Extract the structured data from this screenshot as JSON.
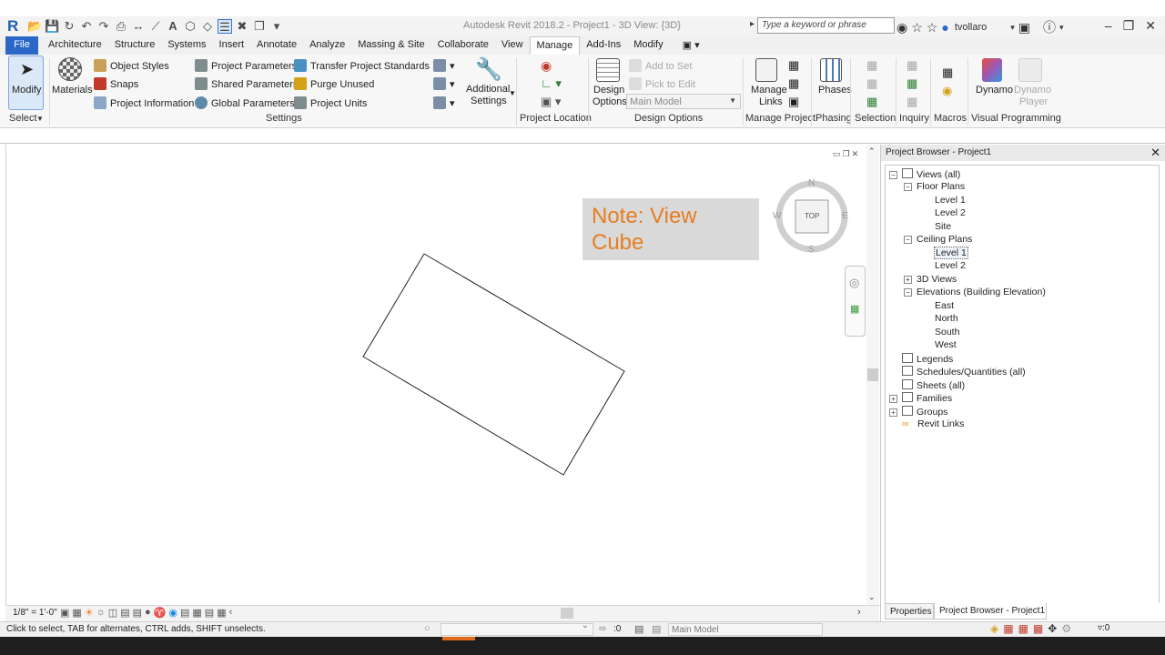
{
  "app": {
    "logo": "R",
    "title": "Autodesk Revit 2018.2 -    Project1 - 3D View: {3D}"
  },
  "search": {
    "placeholder": "Type a keyword or phrase"
  },
  "user": {
    "name": "tvollaro"
  },
  "tabs": [
    "File",
    "Architecture",
    "Structure",
    "Systems",
    "Insert",
    "Annotate",
    "Analyze",
    "Massing & Site",
    "Collaborate",
    "View",
    "Manage",
    "Add-Ins",
    "Modify"
  ],
  "active_tab": "Manage",
  "ribbon": {
    "select": {
      "modify": "Modify",
      "select": "Select"
    },
    "settings": {
      "materials": "Materials",
      "object_styles": "Object  Styles",
      "snaps": "Snaps",
      "project_information": "Project  Information",
      "project_parameters": "Project  Parameters",
      "shared_parameters": "Shared  Parameters",
      "global_parameters": "Global  Parameters",
      "transfer_project_standards": "Transfer  Project Standards",
      "purge_unused": "Purge  Unused",
      "project_units": "Project  Units",
      "panel": "Settings"
    },
    "additional": {
      "line1": "Additional",
      "line2": "Settings"
    },
    "project_location": {
      "panel": "Project Location"
    },
    "design_options": {
      "design": "Design",
      "options": "Options",
      "add_to_set": "Add to Set",
      "pick_to_edit": "Pick to Edit",
      "main_model": "Main Model",
      "panel": "Design Options"
    },
    "manage_project": {
      "manage": "Manage",
      "links": "Links",
      "panel": "Manage Project"
    },
    "phasing": {
      "phases": "Phases",
      "panel": "Phasing"
    },
    "selection": {
      "panel": "Selection"
    },
    "inquiry": {
      "panel": "Inquiry"
    },
    "macros": {
      "panel": "Macros"
    },
    "visual_programming": {
      "dynamo": "Dynamo",
      "dynamo_player_1": "Dynamo",
      "dynamo_player_2": "Player",
      "panel": "Visual Programming"
    }
  },
  "canvas": {
    "note_line1": "Note: View",
    "note_line2": "Cube",
    "viewcube": {
      "top": "TOP",
      "n": "N",
      "s": "S",
      "e": "E",
      "w": "W"
    }
  },
  "viewbar": {
    "scale": "1/8\" = 1'-0\""
  },
  "status": {
    "message": "Click to select, TAB for alternates, CTRL adds, SHIFT unselects.",
    "count": ":0",
    "model": "Main Model",
    "filter": ":0"
  },
  "browser": {
    "title": "Project Browser - Project1",
    "nodes": [
      {
        "label": "Views (all)",
        "toggle": "−"
      },
      {
        "label": "Floor Plans",
        "toggle": "−"
      },
      {
        "label": "Level 1"
      },
      {
        "label": "Level 2"
      },
      {
        "label": "Site"
      },
      {
        "label": "Ceiling Plans",
        "toggle": "−"
      },
      {
        "label": "Level 1"
      },
      {
        "label": "Level 2"
      },
      {
        "label": "3D Views",
        "toggle": "+"
      },
      {
        "label": "Elevations (Building Elevation)",
        "toggle": "−"
      },
      {
        "label": "East"
      },
      {
        "label": "North"
      },
      {
        "label": "South"
      },
      {
        "label": "West"
      },
      {
        "label": "Legends"
      },
      {
        "label": "Schedules/Quantities (all)"
      },
      {
        "label": "Sheets (all)"
      },
      {
        "label": "Families",
        "toggle": "+"
      },
      {
        "label": "Groups",
        "toggle": "+"
      },
      {
        "label": "Revit Links"
      }
    ],
    "tab_properties": "Properties",
    "tab_browser": "Project Browser - Project1"
  }
}
